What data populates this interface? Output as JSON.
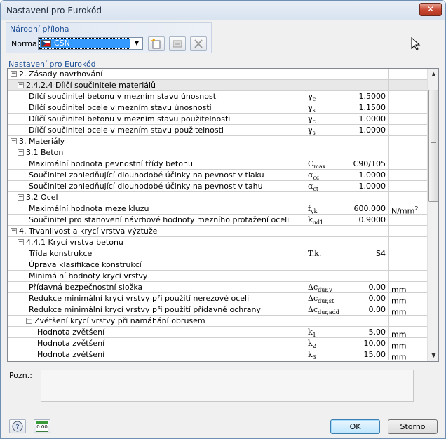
{
  "window": {
    "title": "Nastavení pro Eurokód",
    "close_label": "✕"
  },
  "national_annex": {
    "group_label": "Národní příloha",
    "norma_label": "Norma:",
    "norma_value": "ČSN"
  },
  "section_label": "Nastavení pro Eurokód",
  "rows": [
    {
      "kind": "cat",
      "level": 0,
      "label": "2. Zásady navrhování",
      "sym": "",
      "sub": "",
      "val": "",
      "unit": "",
      "unit_sup": ""
    },
    {
      "kind": "sub",
      "level": 1,
      "label": "2.4.2.4 Dílčí součinitele materiálů",
      "sym": "",
      "sub": "",
      "val": "",
      "unit": "",
      "unit_sup": ""
    },
    {
      "kind": "item",
      "level": 2,
      "label": "Dílčí součinitel betonu v mezním stavu únosnosti",
      "sym": "γ",
      "sub": "c",
      "val": "1.5000",
      "unit": "",
      "unit_sup": ""
    },
    {
      "kind": "item",
      "level": 2,
      "label": "Dílčí součinitel ocele v mezním stavu únosnosti",
      "sym": "γ",
      "sub": "s",
      "val": "1.1500",
      "unit": "",
      "unit_sup": ""
    },
    {
      "kind": "item",
      "level": 2,
      "label": "Dílčí součinitel betonu v mezním stavu použitelnosti",
      "sym": "γ",
      "sub": "c",
      "val": "1.0000",
      "unit": "",
      "unit_sup": ""
    },
    {
      "kind": "item",
      "level": 2,
      "label": "Dílčí součinitel ocele v mezním stavu použitelnosti",
      "sym": "γ",
      "sub": "s",
      "val": "1.0000",
      "unit": "",
      "unit_sup": ""
    },
    {
      "kind": "cat",
      "level": 0,
      "label": "3. Materiály",
      "sym": "",
      "sub": "",
      "val": "",
      "unit": "",
      "unit_sup": ""
    },
    {
      "kind": "sub",
      "level": 1,
      "label": "3.1 Beton",
      "sym": "",
      "sub": "",
      "val": "",
      "unit": "",
      "unit_sup": ""
    },
    {
      "kind": "item",
      "level": 2,
      "label": "Maximální hodnota pevnostní třídy betonu",
      "sym": "C",
      "sub": "max",
      "val": "C90/105",
      "unit": "",
      "unit_sup": ""
    },
    {
      "kind": "item",
      "level": 2,
      "label": "Součinitel zohledňující dlouhodobé účinky na pevnost v tlaku",
      "sym": "α",
      "sub": "cc",
      "val": "1.0000",
      "unit": "",
      "unit_sup": ""
    },
    {
      "kind": "item",
      "level": 2,
      "label": "Součinitel zohledňující dlouhodobé účinky na pevnost v tahu",
      "sym": "α",
      "sub": "ct",
      "val": "1.0000",
      "unit": "",
      "unit_sup": ""
    },
    {
      "kind": "sub",
      "level": 1,
      "label": "3.2 Ocel",
      "sym": "",
      "sub": "",
      "val": "",
      "unit": "",
      "unit_sup": ""
    },
    {
      "kind": "item",
      "level": 2,
      "label": "Maximální hodnota meze kluzu",
      "sym": "f",
      "sub": "yk",
      "val": "600.000",
      "unit": "N/mm",
      "unit_sup": "2"
    },
    {
      "kind": "item",
      "level": 2,
      "label": "Součinitel pro stanovení návrhové hodnoty mezního protažení oceli",
      "sym": "k",
      "sub": "ud1",
      "val": "0.9000",
      "unit": "",
      "unit_sup": ""
    },
    {
      "kind": "cat",
      "level": 0,
      "label": "4. Trvanlivost a krycí vrstva výztuže",
      "sym": "",
      "sub": "",
      "val": "",
      "unit": "",
      "unit_sup": ""
    },
    {
      "kind": "sub",
      "level": 1,
      "label": "4.4.1 Krycí vrstva betonu",
      "sym": "",
      "sub": "",
      "val": "",
      "unit": "",
      "unit_sup": ""
    },
    {
      "kind": "item",
      "level": 2,
      "label": "Třída konstrukce",
      "sym": "T.k.",
      "sub": "",
      "val": "S4",
      "unit": "",
      "unit_sup": ""
    },
    {
      "kind": "item",
      "level": 2,
      "label": "Úprava klasifikace konstrukcí",
      "sym": "",
      "sub": "",
      "val": "",
      "unit": "",
      "unit_sup": ""
    },
    {
      "kind": "item",
      "level": 2,
      "label": "Minimální hodnoty krycí vrstvy",
      "sym": "",
      "sub": "",
      "val": "",
      "unit": "",
      "unit_sup": ""
    },
    {
      "kind": "item",
      "level": 2,
      "label": "Přídavná bezpečnostní složka",
      "sym": "Δc",
      "sub": "dur,γ",
      "val": "0.00",
      "unit": "mm",
      "unit_sup": ""
    },
    {
      "kind": "item",
      "level": 2,
      "label": "Redukce minimální krycí vrstvy při použití nerezové oceli",
      "sym": "Δc",
      "sub": "dur,st",
      "val": "0.00",
      "unit": "mm",
      "unit_sup": ""
    },
    {
      "kind": "item",
      "level": 2,
      "label": "Redukce minimální krycí vrstvy při použití přídavné ochrany",
      "sym": "Δc",
      "sub": "dur,add",
      "val": "0.00",
      "unit": "mm",
      "unit_sup": ""
    },
    {
      "kind": "sub",
      "level": 2,
      "label": "Zvětšení krycí vrstvy při namáhání obrusem",
      "sym": "",
      "sub": "",
      "val": "",
      "unit": "",
      "unit_sup": ""
    },
    {
      "kind": "item",
      "level": 3,
      "label": "Hodnota zvětšení",
      "sym": "k",
      "sub": "1",
      "val": "5.00",
      "unit": "mm",
      "unit_sup": ""
    },
    {
      "kind": "item",
      "level": 3,
      "label": "Hodnota zvětšení",
      "sym": "k",
      "sub": "2",
      "val": "10.00",
      "unit": "mm",
      "unit_sup": ""
    },
    {
      "kind": "item",
      "level": 3,
      "label": "Hodnota zvětšení",
      "sym": "k",
      "sub": "3",
      "val": "15.00",
      "unit": "mm",
      "unit_sup": ""
    }
  ],
  "notes": {
    "label": "Pozn.:",
    "value": ""
  },
  "buttons": {
    "ok": "OK",
    "cancel": "Storno",
    "help_icon": "?",
    "units_icon": "0.00"
  },
  "icons": [
    "new-icon",
    "edit-icon",
    "delete-icon",
    "help-icon",
    "units-icon",
    "cursor-icon"
  ],
  "colors": {
    "accent": "#1d4f96",
    "selection": "#3399ff",
    "close": "#c84630"
  }
}
